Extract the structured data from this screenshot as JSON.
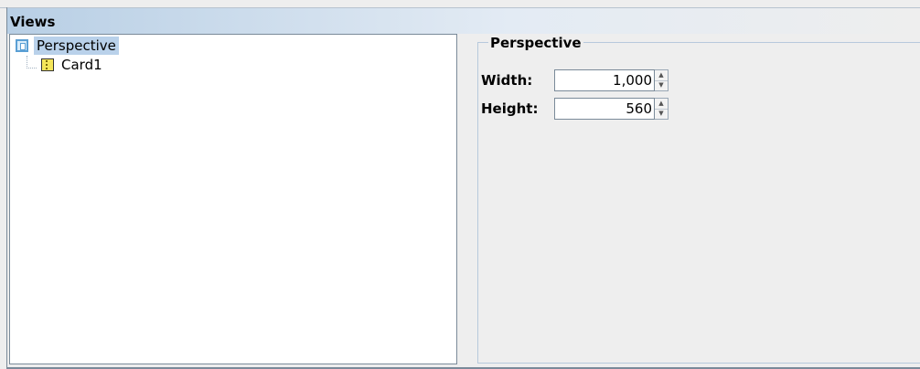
{
  "views": {
    "title": "Views"
  },
  "tree": {
    "root": {
      "label": "Perspective",
      "icon": "perspective-icon"
    },
    "children": [
      {
        "label": "Card1",
        "icon": "card-icon"
      }
    ]
  },
  "properties": {
    "group_title": "Perspective",
    "fields": [
      {
        "label": "Width:",
        "value": "1,000"
      },
      {
        "label": "Height:",
        "value": "560"
      }
    ]
  },
  "colors": {
    "header_gradient_start": "#b8cfe5",
    "selection": "#b9d1ea",
    "background": "#eeeeee",
    "border": "#7a8a99"
  }
}
